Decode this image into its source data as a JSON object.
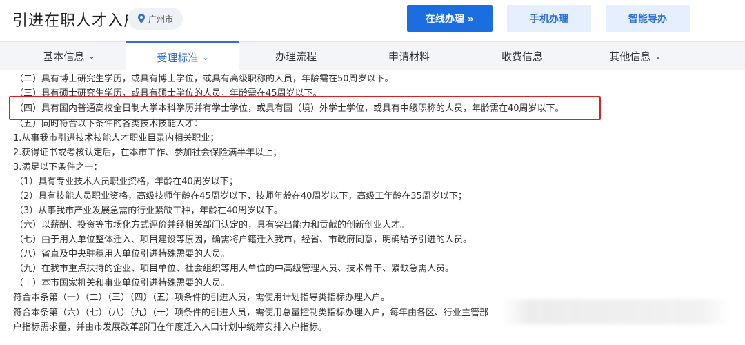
{
  "header": {
    "title": "引进在职人才入户",
    "location": "广州市",
    "buttons": {
      "online": "在线办理 »",
      "mobile": "手机办理",
      "guide": "智能导办"
    }
  },
  "tabs": [
    {
      "label": "基本信息",
      "has_dropdown": true
    },
    {
      "label": "受理标准",
      "has_dropdown": true,
      "active": true
    },
    {
      "label": "办理流程"
    },
    {
      "label": "申请材料"
    },
    {
      "label": "收费信息"
    },
    {
      "label": "其他信息",
      "has_dropdown": true
    }
  ],
  "content": {
    "lines": [
      "（二）具有博士研究生学历，或具有博士学位，或具有高级职称的人员，年龄需在50周岁以下。",
      "（三）具有硕士研究生学历，或具有硕士学位的人员，年龄需在45周岁以下。",
      "（四）具有国内普通高校全日制大学本科学历并有学士学位，或具有国（境）外学士学位，或具有中级职称的人员，年龄需在40周岁以下。",
      "（五）同时符合以下条件的各类技术技能人才：",
      "1.从事我市引进技术技能人才职业目录内相关职业；",
      "2.获得证书或考核认定后，在本市工作、参加社会保险满半年以上；",
      "3.满足以下条件之一：",
      "（1）具有专业技术人员职业资格，年龄在40周岁以下；",
      "（2）具有技能人员职业资格，高级技师年龄在45周岁以下，技师年龄在40周岁以下，高级工年龄在35周岁以下；",
      "（3）从事我市产业发展急需的行业紧缺工种，年龄在40周岁以下。",
      "（六）以薪酬、投资等市场化方式评价并经相关部门认定的，具有突出能力和贡献的创新创业人才。",
      "（七）由于用人单位整体迁入、项目建设等原因，确需将户籍迁入我市，经省、市政府同意，明确给予引进的人员。",
      "（八）省直及中央驻穗用人单位引进特殊需要的人员。",
      "（九）在我市重点扶持的企业、项目单位、社会组织等用人单位的中高级管理人员、技术骨干、紧缺急需人员。",
      "（十）本市国家机关和事业单位引进特殊需要的人员。",
      "符合本条第（一）（二）（三）（四）（五）项条件的引进人员，需使用计划指导类指标办理入户。",
      "符合本条第（六）（七）（八）（九）（十）项条件的引进人员，需使用总量控制类指标办理入户，每年由各区、行业主管部",
      "户指标需求量，并由市发展改革部门在年度迁入人口计划中统筹安排入户指标。"
    ]
  }
}
